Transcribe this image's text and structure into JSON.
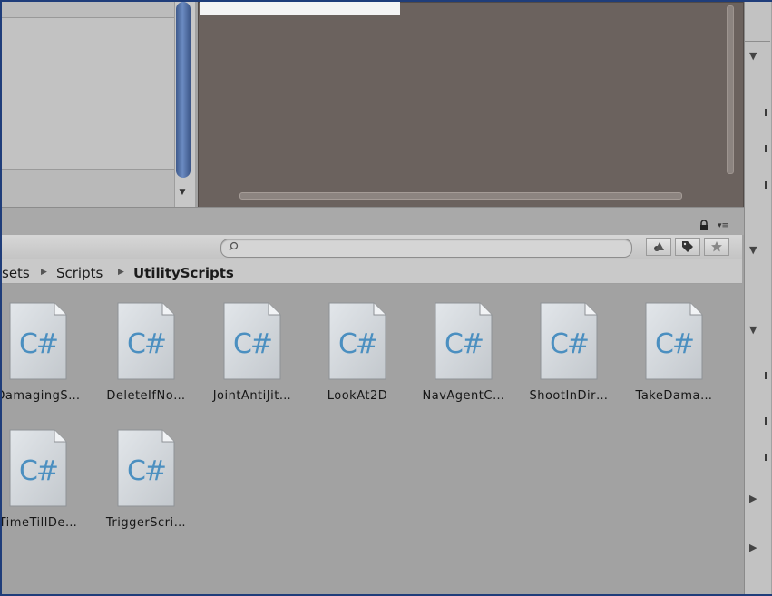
{
  "breadcrumb": {
    "items": [
      "sets",
      "Scripts",
      "UtilityScripts"
    ]
  },
  "search": {
    "placeholder": ""
  },
  "toolbar": {
    "buttons": [
      "filter-by-type",
      "filter-by-label",
      "favorites"
    ]
  },
  "assets": [
    {
      "name": "DamagingS…",
      "icon": "csharp-script-icon"
    },
    {
      "name": "DeleteIfNo…",
      "icon": "csharp-script-icon"
    },
    {
      "name": "JointAntiJit…",
      "icon": "csharp-script-icon"
    },
    {
      "name": "LookAt2D",
      "icon": "csharp-script-icon"
    },
    {
      "name": "NavAgentC…",
      "icon": "csharp-script-icon"
    },
    {
      "name": "ShootInDir…",
      "icon": "csharp-script-icon"
    },
    {
      "name": "TakeDama…",
      "icon": "csharp-script-icon"
    },
    {
      "name": "TimeTillDe…",
      "icon": "csharp-script-icon"
    },
    {
      "name": "TriggerScri…",
      "icon": "csharp-script-icon"
    }
  ],
  "icon_glyph": "C#",
  "colors": {
    "scene_bg": "#6b625e",
    "panel_bg": "#a2a2a2",
    "scrollbar_blue": "#4d6aa0",
    "csharp_blue": "#4b8fc0"
  }
}
